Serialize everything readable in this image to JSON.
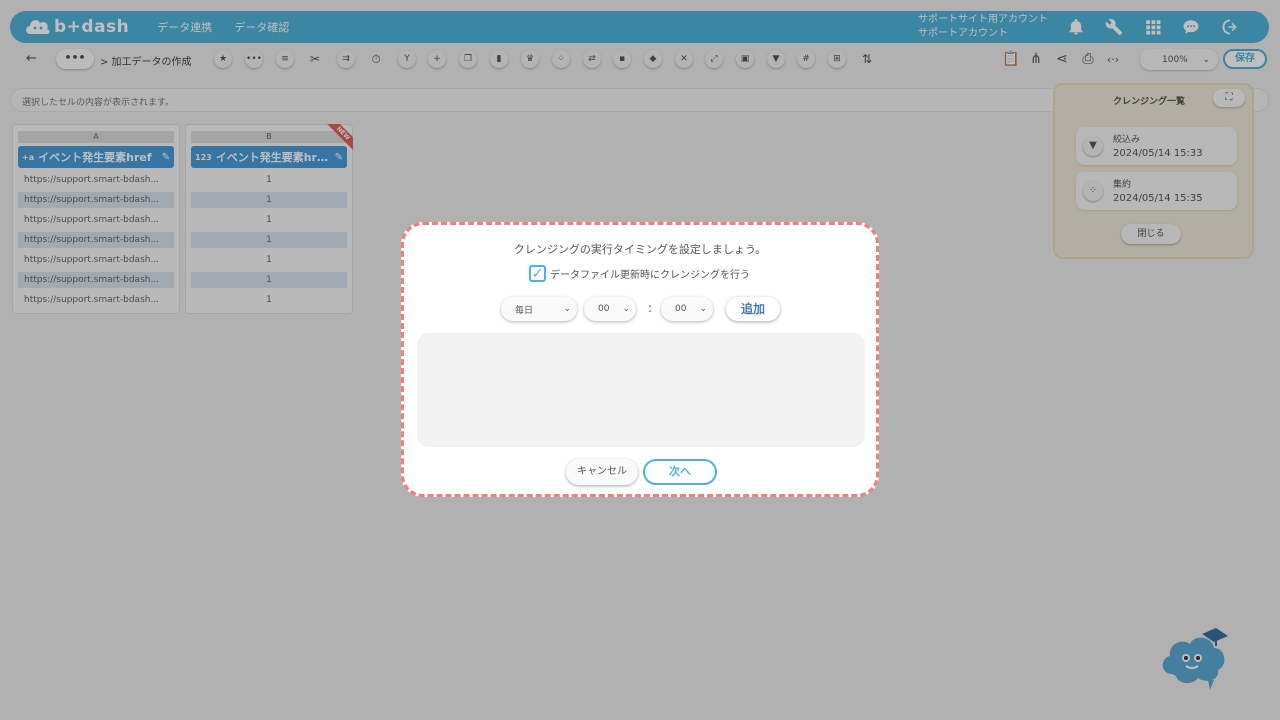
{
  "header": {
    "logo_text": "b+dash",
    "nav": [
      "データ連携",
      "データ確認"
    ],
    "account_line1": "サポートサイト用アカウント",
    "account_line2": "サポートアカウント",
    "icons": [
      "bell-icon",
      "wrench-icon",
      "grid-apps-icon",
      "chat-icon",
      "logout-icon"
    ]
  },
  "toolbar": {
    "back": "←",
    "more": "•••",
    "breadcrumb": "> 加工データの作成",
    "tools": [
      "star-icon",
      "more-icon",
      "list-icon",
      "tools-icon",
      "merge-icon",
      "timer-icon",
      "branch-icon",
      "plus-icon",
      "copy-icon",
      "trash-icon",
      "crown-icon",
      "collapse-icon",
      "swap-icon",
      "lock-icon",
      "cube-icon",
      "close-circle-icon",
      "expand-icon",
      "box-icon",
      "filter-icon",
      "hash-icon",
      "table-icon",
      "sort-icon"
    ],
    "right_icons": [
      "clipboard-icon",
      "network-icon",
      "share-icon",
      "doc-search-icon",
      "code-icon"
    ],
    "zoom": "100%",
    "save": "保存"
  },
  "cellbar": {
    "placeholder": "選択したセルの内容が表示されます。"
  },
  "columns": [
    {
      "letter": "A",
      "type": "+a",
      "name": "イベント発生要素href",
      "cells": [
        "https://support.smart-bdash...",
        "https://support.smart-bdash...",
        "https://support.smart-bdash...",
        "https://support.smart-bdash...",
        "https://support.smart-bdash...",
        "https://support.smart-bdash...",
        "https://support.smart-bdash..."
      ]
    },
    {
      "letter": "B",
      "type": "123",
      "name": "イベント発生要素hr…",
      "badge": "NEW",
      "cells": [
        "1",
        "1",
        "1",
        "1",
        "1",
        "1",
        "1"
      ]
    }
  ],
  "cleansing_panel": {
    "title": "クレンジング一覧",
    "expand": "⛶",
    "items": [
      {
        "icon": "filter-icon",
        "name": "絞込み",
        "date": "2024/05/14 15:33"
      },
      {
        "icon": "aggregate-icon",
        "name": "集約",
        "date": "2024/05/14 15:35"
      }
    ],
    "close": "閉じる"
  },
  "modal": {
    "title": "クレンジングの実行タイミングを設定しましょう。",
    "checkbox_checked": true,
    "checkbox_label": "データファイル更新時にクレンジングを行う",
    "frequency": "毎日",
    "hour": "00",
    "colon": ":",
    "minute": "00",
    "add": "追加",
    "cancel": "キャンセル",
    "next": "次へ"
  },
  "colors": {
    "accent": "#4fb3d9",
    "header_col": "#4a9dd8",
    "modal_border": "#f07f82",
    "panel_bg": "#efe9d8"
  }
}
